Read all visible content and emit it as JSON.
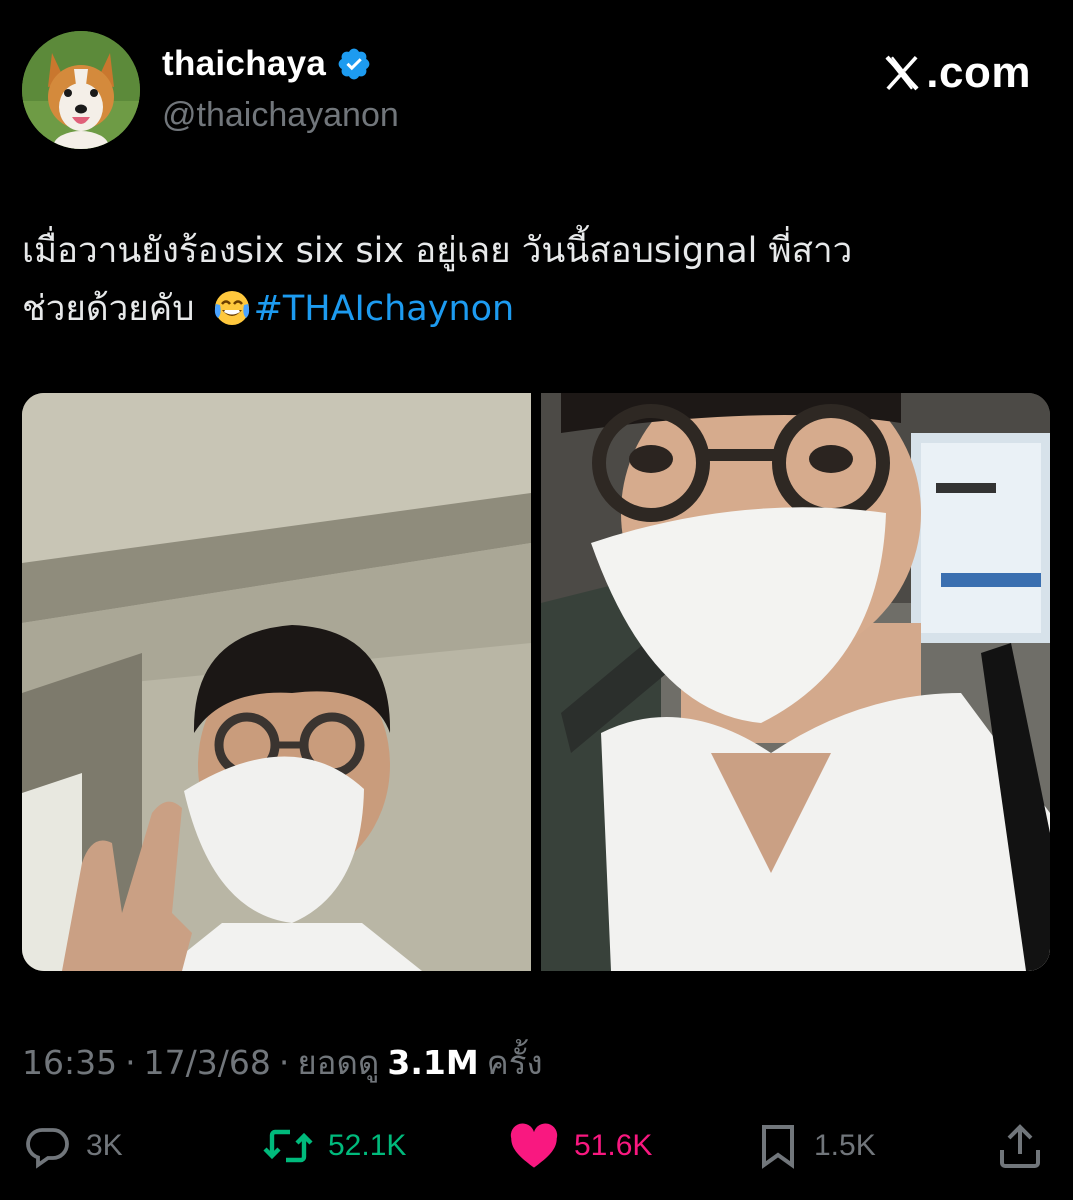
{
  "author": {
    "display_name": "thaichaya",
    "handle": "@thaichayanon",
    "verified": true,
    "avatar": "corgi-avatar"
  },
  "brand": {
    "text": ".com"
  },
  "tweet": {
    "text_line1": "เมื่อวานยังร้องsix six six อยู่เลย วันนี้สอบsignal พี่สาว",
    "text_line2": "ช่วยด้วยคับ ",
    "emoji": "face-with-tears-of-joy",
    "hashtag": "#THAIchaynon"
  },
  "media": [
    {
      "description_icon": "photo-selfie-peace-sign"
    },
    {
      "description_icon": "photo-selfie-closeup"
    }
  ],
  "meta": {
    "time": "16:35",
    "sep1": "·",
    "date": "17/3/68",
    "sep2": "·",
    "views_label": "ยอดดู",
    "views_count": "3.1M",
    "views_suffix": "ครั้ง"
  },
  "actions": {
    "replies": "3K",
    "reposts": "52.1K",
    "likes": "51.6K",
    "bookmarks": "1.5K"
  },
  "colors": {
    "background": "#000000",
    "text": "#e7e9ea",
    "muted": "#71767b",
    "link": "#1d9bf0",
    "repost": "#00ba7c",
    "like": "#f91880",
    "verified": "#1d9bf0"
  }
}
